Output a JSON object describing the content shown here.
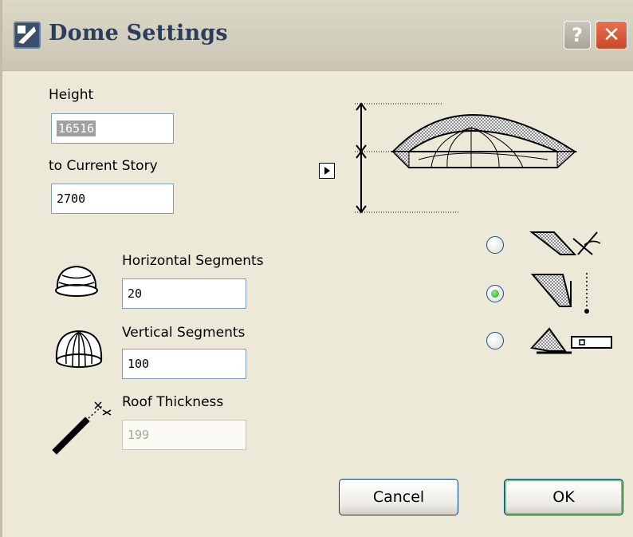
{
  "window": {
    "title": "Dome Settings",
    "help_label": "?",
    "close_label": "✕"
  },
  "height": {
    "label": "Height",
    "value": "16516"
  },
  "story": {
    "label": "to Current Story",
    "value": "2700"
  },
  "horizontal_segments": {
    "label": "Horizontal Segments",
    "value": "20"
  },
  "vertical_segments": {
    "label": "Vertical Segments",
    "value": "100"
  },
  "roof_thickness": {
    "label": "Roof Thickness",
    "value": "199"
  },
  "options": [
    {
      "name": "angle",
      "selected": false
    },
    {
      "name": "vertical",
      "selected": true
    },
    {
      "name": "horizontal",
      "selected": false
    }
  ],
  "buttons": {
    "cancel": "Cancel",
    "ok": "OK"
  }
}
